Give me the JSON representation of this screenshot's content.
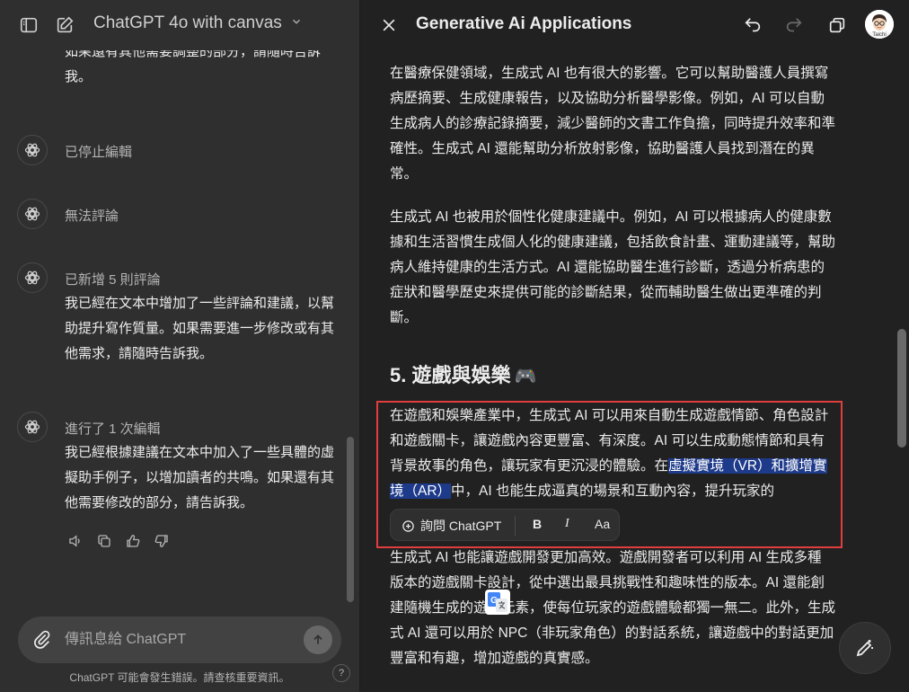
{
  "left_panel": {
    "header": {
      "model_title": "ChatGPT 4o with canvas"
    },
    "top_text": "如果還有其他需要調整的部分，請隨時告訴我。",
    "messages": [
      {
        "status": "已停止編輯"
      },
      {
        "status": "無法評論"
      },
      {
        "status": "已新增 5 則評論",
        "text": "我已經在文本中增加了一些評論和建議，以幫助提升寫作質量。如果需要進一步修改或有其他需求，請隨時告訴我。"
      },
      {
        "status": "進行了 1 次編輯",
        "text": "我已經根據建議在文本中加入了一些具體的虛擬助手例子，以增加讀者的共鳴。如果還有其他需要修改的部分，請告訴我。"
      }
    ],
    "composer": {
      "placeholder": "傳訊息給 ChatGPT"
    },
    "disclaimer": "ChatGPT 可能會發生錯誤。請查核重要資訊。",
    "help_label": "?"
  },
  "right_panel": {
    "header": {
      "title": "Generative Ai Applications",
      "profile_badge": "Taichi"
    },
    "paragraphs": [
      "在醫療保健領域，生成式 AI 也有很大的影響。它可以幫助醫護人員撰寫病歷摘要、生成健康報告，以及協助分析醫學影像。例如，AI 可以自動生成病人的診療記錄摘要，減少醫師的文書工作負擔，同時提升效率和準確性。生成式 AI 還能幫助分析放射影像，協助醫護人員找到潛在的異常。",
      "生成式 AI 也被用於個性化健康建議中。例如，AI 可以根據病人的健康數據和生活習慣生成個人化的健康建議，包括飲食計畫、運動建議等，幫助病人維持健康的生活方式。AI 還能協助醫生進行診斷，透過分析病患的症狀和醫學歷史來提供可能的診斷結果，從而輔助醫生做出更準確的判斷。"
    ],
    "section_heading": "5. 遊戲與娛樂",
    "section_emoji": "🎮",
    "selected_paragraph": {
      "before": "在遊戲和娛樂產業中，生成式 AI 可以用來自動生成遊戲情節、角色設計和遊戲關卡，讓遊戲內容更豐富、有深度。AI 可以生成動態情節和具有背景故事的角色，讓玩家有更沉浸的體驗。在",
      "highlight": "虛擬實境（VR）和擴增實境（AR）",
      "after": "中，AI 也能生成逼真的場景和互動內容，提升玩家的"
    },
    "toolbar": {
      "ask_label": "詢問 ChatGPT",
      "bold_label": "B",
      "italic_label": "I",
      "size_label": "Aa"
    },
    "last_paragraph": "生成式 AI 也能讓遊戲開發更加高效。遊戲開發者可以利用 AI 生成多種版本的遊戲關卡設計，從中選出最具挑戰性和趣味性的版本。AI 還能創建隨機生成的遊戲元素，使每位玩家的遊戲體驗都獨一無二。此外，生成式 AI 還可以用於 NPC（非玩家角色）的對話系統，讓遊戲中的對話更加豐富和有趣，增加遊戲的真實感。"
  },
  "colors": {
    "left_bg": "#2f2f2f",
    "right_bg": "#212121",
    "highlight": "#1e3a8a",
    "selection_border": "#e03e3e"
  }
}
